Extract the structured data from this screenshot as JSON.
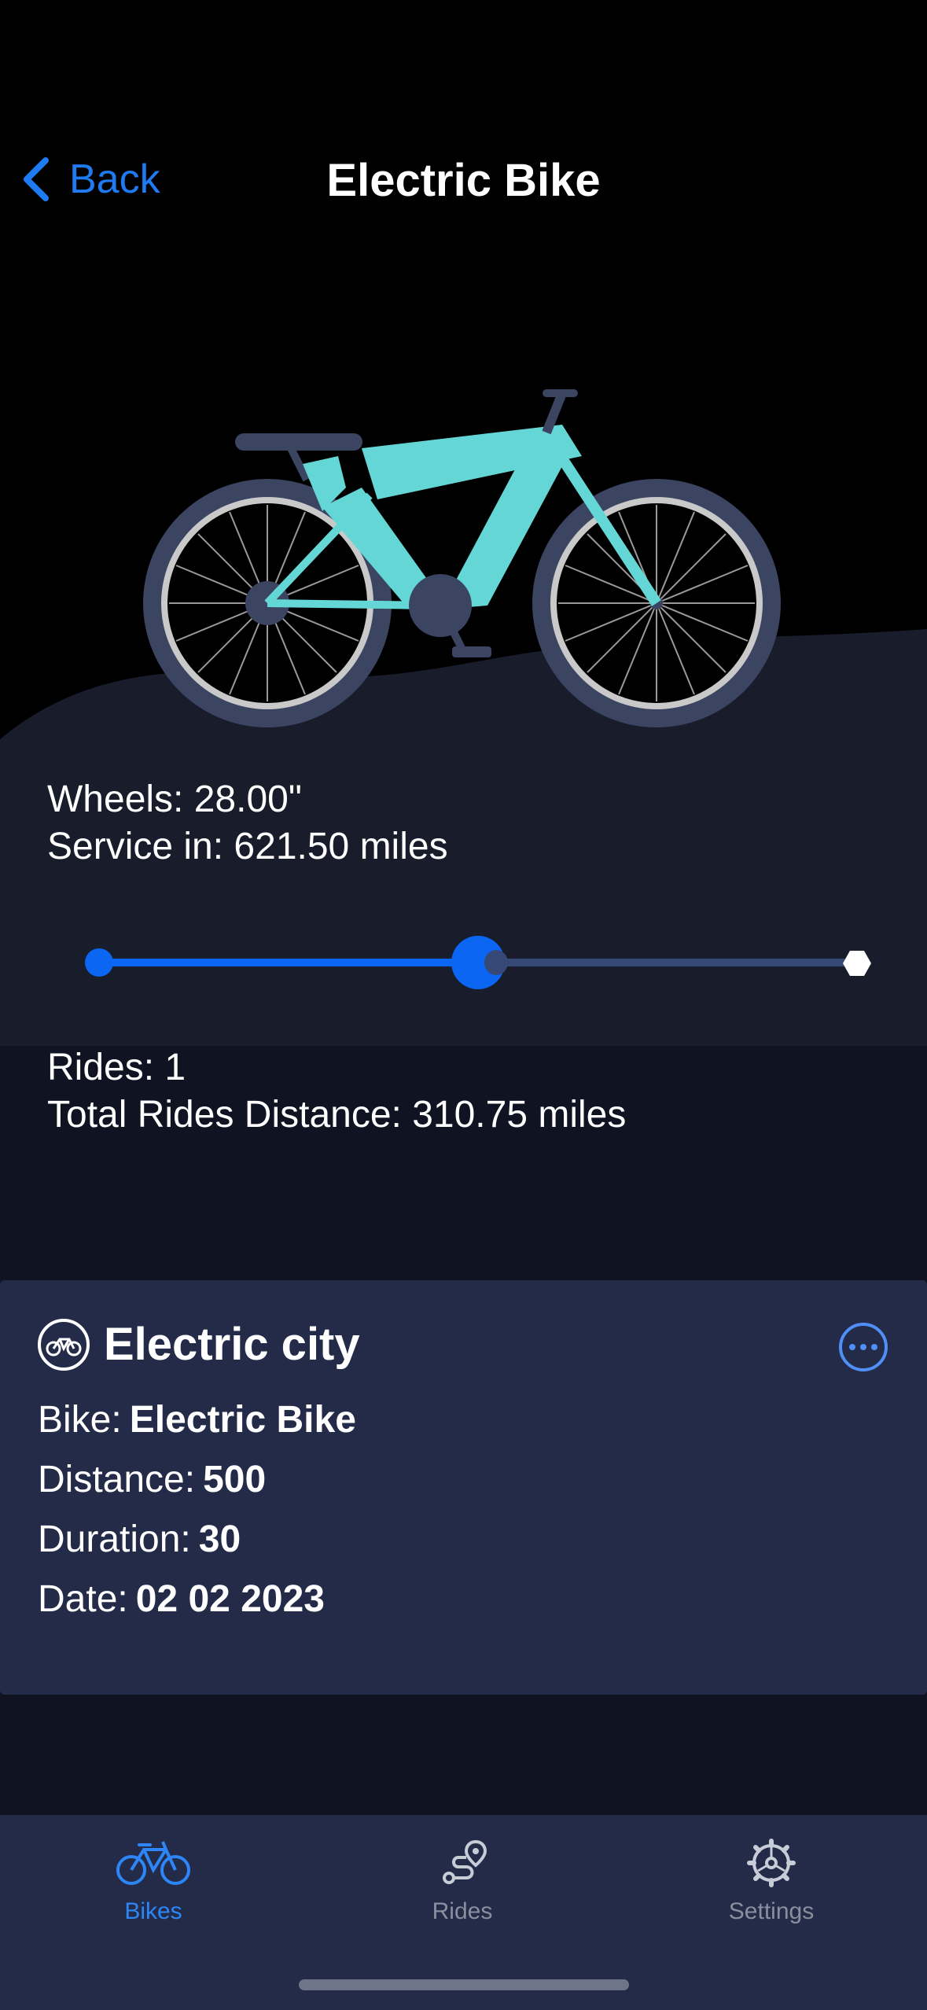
{
  "header": {
    "back_label": "Back",
    "title": "Electric Bike"
  },
  "bike_info": {
    "wheels": "Wheels: 28.00\"",
    "service": "Service in: 621.50 miles",
    "service_progress": 0.5
  },
  "stats": {
    "rides": "Rides: 1",
    "total_distance": "Total Rides Distance: 310.75 miles"
  },
  "ride_card": {
    "title": "Electric city",
    "rows": [
      {
        "label": "Bike:",
        "value": "Electric Bike"
      },
      {
        "label": "Distance:",
        "value": "500"
      },
      {
        "label": "Duration:",
        "value": "30"
      },
      {
        "label": "Date:",
        "value": "02 02 2023"
      }
    ]
  },
  "tabs": [
    {
      "label": "Bikes",
      "icon": "bicycle-icon",
      "active": true
    },
    {
      "label": "Rides",
      "icon": "route-icon",
      "active": false
    },
    {
      "label": "Settings",
      "icon": "gear-icon",
      "active": false
    }
  ],
  "colors": {
    "accent": "#0B66F3",
    "bike_frame": "#64D6D6",
    "card_bg": "#232B48",
    "track_bg": "#364875"
  }
}
